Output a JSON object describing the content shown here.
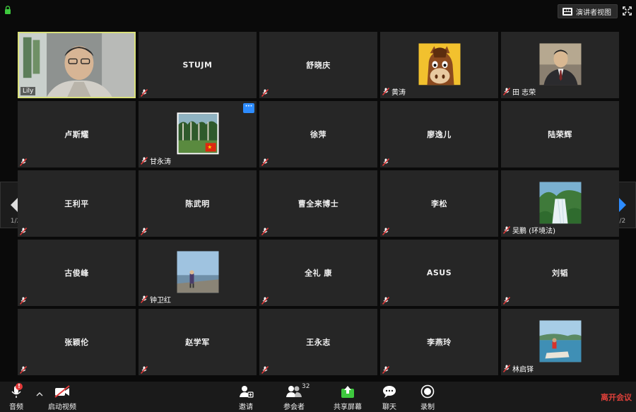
{
  "topbar": {
    "speaker_view_label": "演讲者视图",
    "icons": {
      "lock": "lock-icon",
      "speaker_view": "gallery-grid-icon",
      "fullscreen": "fullscreen-icon"
    }
  },
  "participants": [
    {
      "name": "Lily",
      "type": "video"
    },
    {
      "name": "STUJM",
      "type": "name"
    },
    {
      "name": "舒晓庆",
      "type": "name"
    },
    {
      "name": "黄涛",
      "type": "avatar",
      "avatar": "cartoon-horse-avatar"
    },
    {
      "name": "田 志荣",
      "type": "avatar",
      "avatar": "man-in-suit-photo"
    },
    {
      "name": "卢斯耀",
      "type": "name"
    },
    {
      "name": "甘永涛",
      "type": "avatar",
      "avatar": "forest-photo",
      "has_menu": true
    },
    {
      "name": "徐萍",
      "type": "name"
    },
    {
      "name": "廖逸儿",
      "type": "name"
    },
    {
      "name": "陆荣辉",
      "type": "name"
    },
    {
      "name": "王利平",
      "type": "name"
    },
    {
      "name": "陈武明",
      "type": "name"
    },
    {
      "name": "曹全来博士",
      "type": "name"
    },
    {
      "name": "李松",
      "type": "name"
    },
    {
      "name": "吴鹏 (环境法)",
      "type": "avatar",
      "avatar": "waterfall-photo"
    },
    {
      "name": "古俊峰",
      "type": "name"
    },
    {
      "name": "钟卫红",
      "type": "avatar",
      "avatar": "seaside-photo"
    },
    {
      "name": "全礼 康",
      "type": "name"
    },
    {
      "name": "ASUS",
      "type": "name"
    },
    {
      "name": "刘韬",
      "type": "name"
    },
    {
      "name": "张颖伦",
      "type": "name"
    },
    {
      "name": "赵学军",
      "type": "name"
    },
    {
      "name": "王永志",
      "type": "name"
    },
    {
      "name": "李燕玲",
      "type": "name"
    },
    {
      "name": "林启铎",
      "type": "avatar",
      "avatar": "lake-photo"
    }
  ],
  "pagination": {
    "left": "1/2",
    "right": "1/2"
  },
  "toolbar": {
    "audio_label": "音频",
    "audio_alert": "!",
    "video_label": "启动视频",
    "invite_label": "邀请",
    "participants_label": "参会者",
    "participants_count": "32",
    "share_label": "共享屏幕",
    "chat_label": "聊天",
    "record_label": "录制",
    "leave_label": "离开会议"
  },
  "colors": {
    "active_border": "#d9e07c",
    "share_green": "#3ec93e",
    "leave_red": "#e0403a",
    "accent_blue": "#2d8cff"
  }
}
